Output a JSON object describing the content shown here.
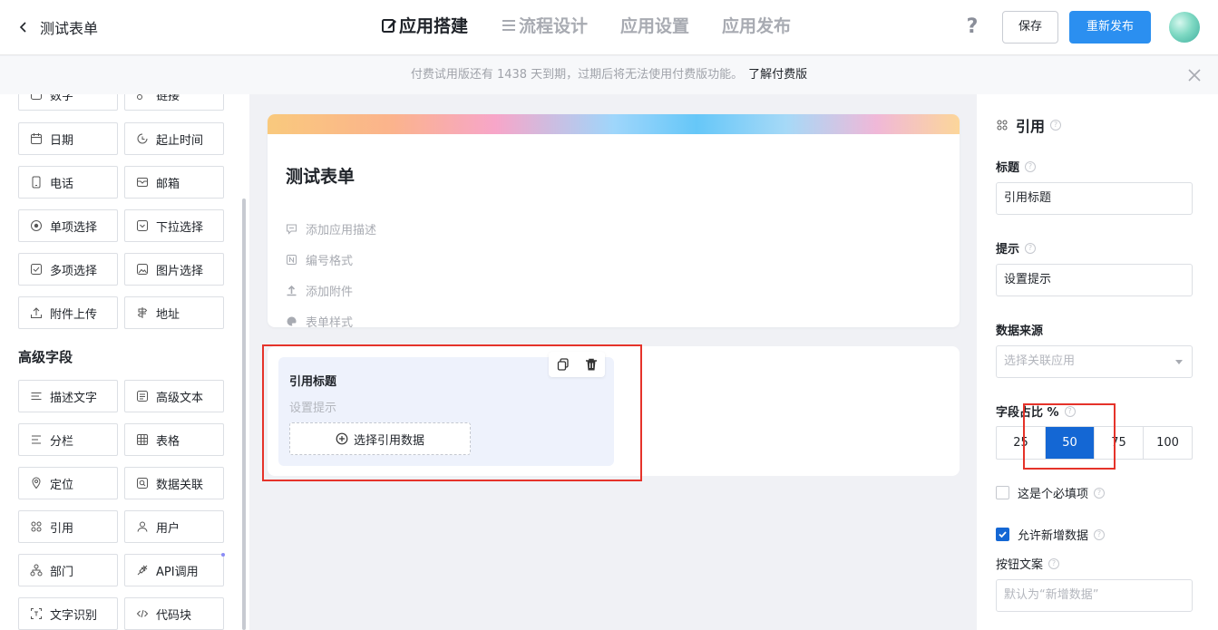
{
  "header": {
    "back_title": "测试表单",
    "nav": [
      "应用搭建",
      "流程设计",
      "应用设置",
      "应用发布"
    ],
    "help": "?",
    "save_label": "保存",
    "publish_label": "重新发布"
  },
  "notice": {
    "text": "付费试用版还有 1438 天到期，过期后将无法使用付费版功能。",
    "link": "了解付费版"
  },
  "left_panel": {
    "partial_top": [
      "数字",
      "链接"
    ],
    "basic_fields": [
      "日期",
      "起止时间",
      "电话",
      "邮箱",
      "单项选择",
      "下拉选择",
      "多项选择",
      "图片选择",
      "附件上传",
      "地址"
    ],
    "advanced_title": "高级字段",
    "advanced_fields": [
      "描述文字",
      "高级文本",
      "分栏",
      "表格",
      "定位",
      "数据关联",
      "引用",
      "用户",
      "部门",
      "API调用",
      "文字识别",
      "代码块"
    ]
  },
  "form": {
    "title": "测试表单",
    "meta": [
      "添加应用描述",
      "编号格式",
      "添加附件",
      "表单样式"
    ],
    "field": {
      "title": "引用标题",
      "hint": "设置提示",
      "select_label": "选择引用数据"
    }
  },
  "right_panel": {
    "title": "引用",
    "title_label": "标题",
    "title_value": "引用标题",
    "hint_label": "提示",
    "hint_value": "设置提示",
    "source_label": "数据来源",
    "source_placeholder": "选择关联应用",
    "width_label": "字段占比 %",
    "width_options": [
      "25",
      "50",
      "75",
      "100"
    ],
    "width_selected": "50",
    "required_label": "这是个必填项",
    "required_checked": false,
    "allow_add_label": "允许新增数据",
    "allow_add_checked": true,
    "button_text_label": "按钮文案",
    "button_text_placeholder": "默认为“新增数据”"
  },
  "colors": {
    "primary": "#2b8ff0",
    "selected_segment": "#1467d4",
    "highlight_box": "#e5332a"
  }
}
